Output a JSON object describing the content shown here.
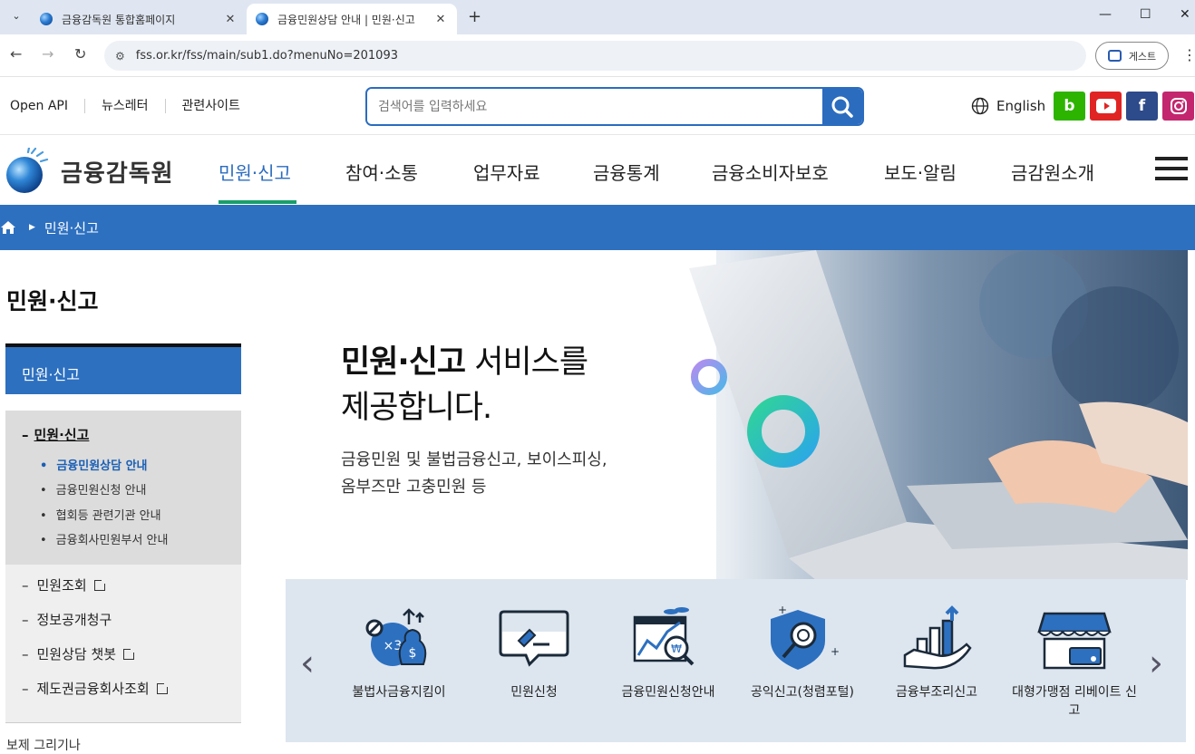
{
  "browser": {
    "tabs": [
      {
        "title": "금융감독원 통합홈페이지",
        "active": false
      },
      {
        "title": "금융민원상담 안내 | 민원·신고",
        "active": true
      }
    ],
    "new_tab": "+",
    "url": "fss.or.kr/fss/main/sub1.do?menuNo=201093",
    "profile_label": "게스트"
  },
  "util": {
    "links": [
      "Open API",
      "뉴스레터",
      "관련사이트"
    ],
    "search_placeholder": "검색어를 입력하세요",
    "language": "English",
    "sns": [
      {
        "name": "blog",
        "glyph": "b",
        "color": "#2db400"
      },
      {
        "name": "youtube",
        "glyph": "▶",
        "color": "#e02424"
      },
      {
        "name": "facebook",
        "glyph": "f",
        "color": "#2d4a8a"
      },
      {
        "name": "instagram",
        "glyph": "◎",
        "color": "#c3266e"
      }
    ]
  },
  "gnb": {
    "logo": "금융감독원",
    "items": [
      "민원·신고",
      "참여·소통",
      "업무자료",
      "금융통계",
      "금융소비자보호",
      "보도·알림",
      "금감원소개"
    ],
    "active_index": 0
  },
  "breadcrumb": {
    "current": "민원·신고"
  },
  "sidebar": {
    "page_title": "민원·신고",
    "header": "민원·신고",
    "group": "민원·신고",
    "children": [
      "금융민원상담 안내",
      "금융민원신청 안내",
      "협회등 관련기관 안내",
      "금융회사민원부서 안내"
    ],
    "active_child": 0,
    "items": [
      {
        "label": "민원조회",
        "external": true
      },
      {
        "label": "정보공개청구",
        "external": false
      },
      {
        "label": "민원상담 챗봇",
        "external": true
      },
      {
        "label": "제도권금융회사조회",
        "external": true
      }
    ],
    "cut_off_label": "보제 그리기나"
  },
  "hero": {
    "title_bold": "민원·신고",
    "title_rest": " 서비스를",
    "title_line2": "제공합니다.",
    "desc_line1": "금융민원 및 불법금융신고, 보이스피싱,",
    "desc_line2": "옴부즈만 고충민원 등"
  },
  "services": [
    {
      "label": "불법사금융지킴이",
      "icon": "money-bag-icon"
    },
    {
      "label": "민원신청",
      "icon": "speech-pen-icon"
    },
    {
      "label": "금융민원신청안내",
      "icon": "chart-magnifier-icon"
    },
    {
      "label": "공익신고(청렴포털)",
      "icon": "shield-search-icon"
    },
    {
      "label": "금융부조리신고",
      "icon": "hand-chart-icon"
    },
    {
      "label": "대형가맹점 리베이트 신고",
      "icon": "store-card-icon"
    }
  ],
  "colors": {
    "brand": "#2d70c0",
    "accent_green": "#1a9e6a",
    "service_bg": "#dde6ef"
  }
}
